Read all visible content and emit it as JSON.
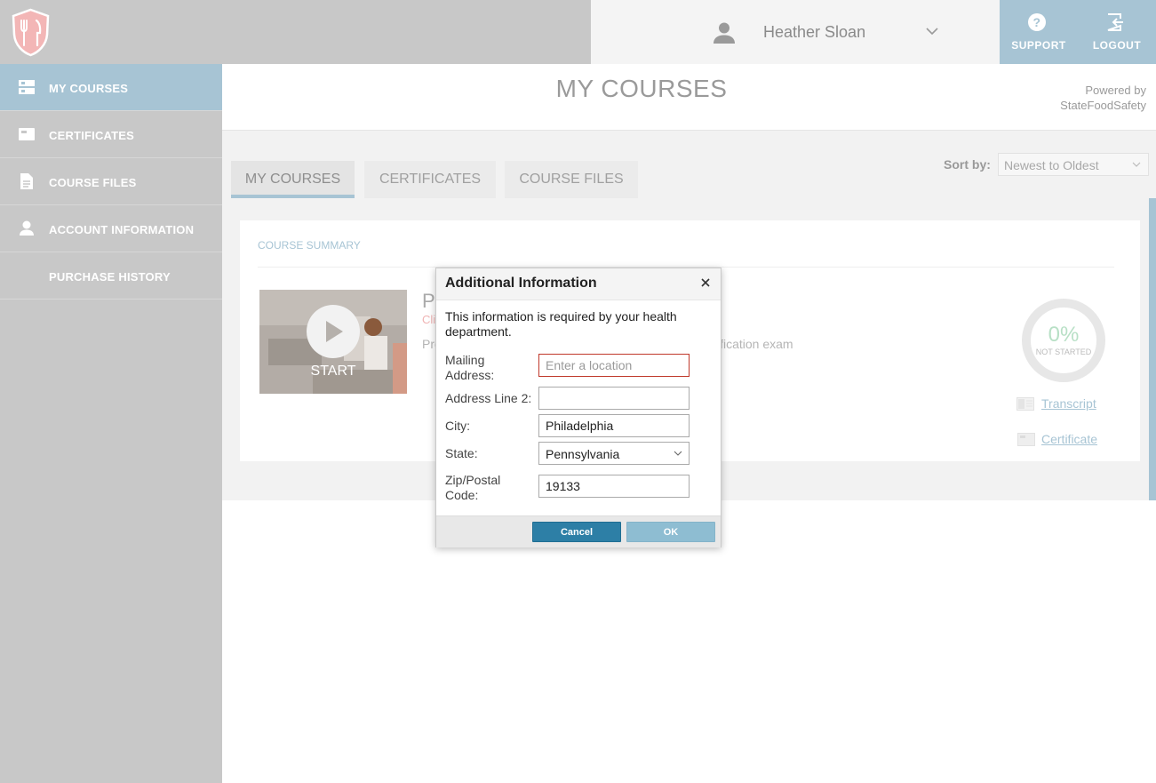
{
  "header": {
    "user_name": "Heather Sloan",
    "support_label": "SUPPORT",
    "logout_label": "LOGOUT"
  },
  "sidebar": {
    "items": [
      {
        "label": "MY COURSES",
        "icon": "courses-icon",
        "active": true
      },
      {
        "label": "CERTIFICATES",
        "icon": "certificate-icon",
        "active": false
      },
      {
        "label": "COURSE FILES",
        "icon": "file-icon",
        "active": false
      },
      {
        "label": "ACCOUNT INFORMATION",
        "icon": "person-icon",
        "active": false
      },
      {
        "label": "PURCHASE HISTORY",
        "icon": "",
        "active": false
      }
    ]
  },
  "main": {
    "title": "MY COURSES",
    "powered_by_line1": "Powered by",
    "powered_by_line2": "StateFoodSafety",
    "tabs": [
      {
        "label": "MY COURSES",
        "active": true
      },
      {
        "label": "CERTIFICATES",
        "active": false
      },
      {
        "label": "COURSE FILES",
        "active": false
      }
    ],
    "sort_label": "Sort by:",
    "sort_value": "Newest to Oldest"
  },
  "card": {
    "section_label": "COURSE SUMMARY",
    "start_label": "START",
    "course_title_partial": "P",
    "course_sub_partial": "Cli",
    "course_desc_partial_left": "Pro",
    "course_desc_partial_right": "ification exam",
    "progress_pct": "0%",
    "progress_status": "NOT STARTED",
    "transcript_label": "Transcript",
    "certificate_label": "Certificate"
  },
  "dialog": {
    "title": "Additional Information",
    "intro": "This information is required by your health department.",
    "fields": {
      "mailing_label": "Mailing Address:",
      "mailing_placeholder": "Enter a location",
      "mailing_value": "",
      "address2_label": "Address Line 2:",
      "address2_value": "",
      "city_label": "City:",
      "city_value": "Philadelphia",
      "state_label": "State:",
      "state_value": "Pennsylvania",
      "zip_label": "Zip/Postal Code:",
      "zip_value": "19133"
    },
    "cancel_label": "Cancel",
    "ok_label": "OK"
  },
  "colors": {
    "accent": "#a7c4d4",
    "sidebar_bg": "#c8c8c8",
    "button_primary": "#2d7fa6",
    "error_border": "#c0392b"
  }
}
